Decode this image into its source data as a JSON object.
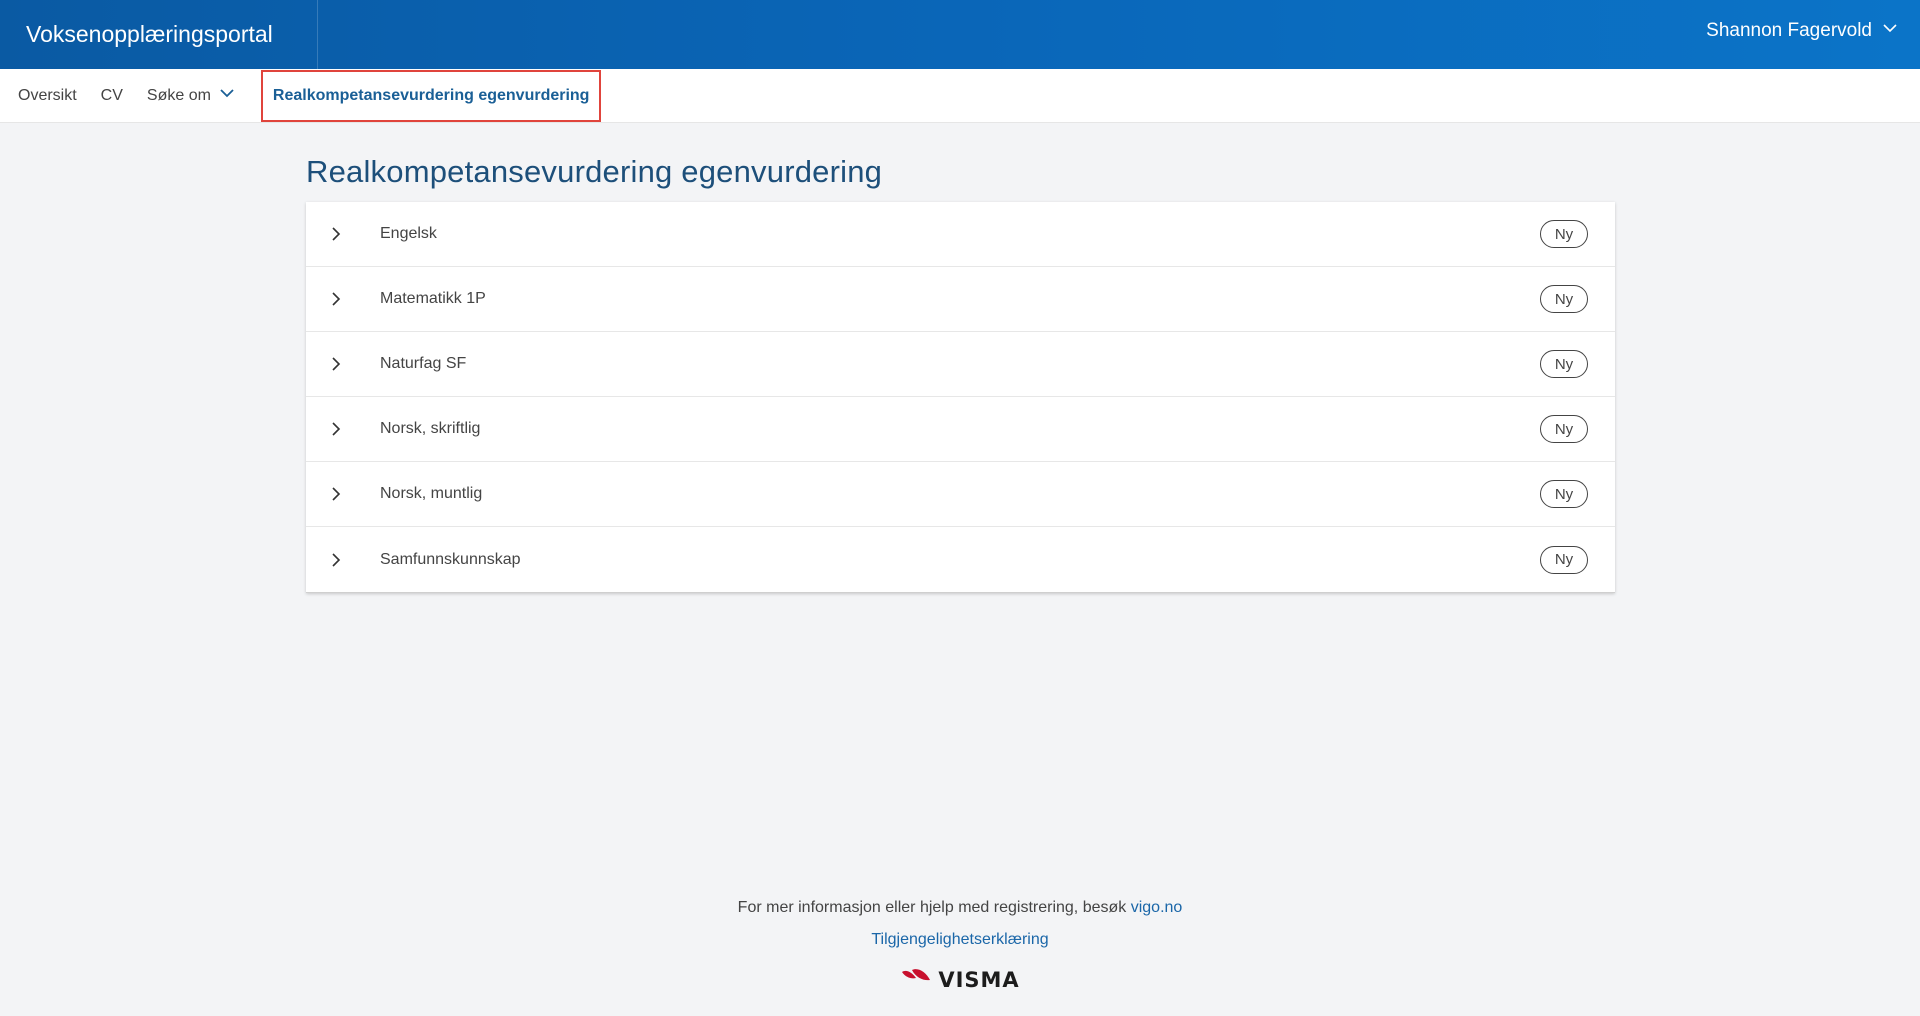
{
  "header": {
    "brand": "Voksenopplæringsportal",
    "user_name": "Shannon Fagervold",
    "user_icon": "chevron-down-icon"
  },
  "nav": {
    "items": [
      {
        "label": "Oversikt"
      },
      {
        "label": "CV"
      },
      {
        "label": "Søke om",
        "icon": "chevron-down-icon"
      },
      {
        "label": "Realkompetansevurdering egenvurdering",
        "active": true
      }
    ]
  },
  "main": {
    "title": "Realkompetansevurdering egenvurdering",
    "rows": [
      {
        "label": "Engelsk",
        "badge": "Ny"
      },
      {
        "label": "Matematikk 1P",
        "badge": "Ny"
      },
      {
        "label": "Naturfag SF",
        "badge": "Ny"
      },
      {
        "label": "Norsk, skriftlig",
        "badge": "Ny"
      },
      {
        "label": "Norsk, muntlig",
        "badge": "Ny"
      },
      {
        "label": "Samfunnskunnskap",
        "badge": "Ny"
      }
    ]
  },
  "footer": {
    "info_text": "For mer informasjon eller hjelp med registrering, besøk",
    "info_link": "vigo.no",
    "accessibility_link": "Tilgjengelighetserklæring",
    "logo_text": "VISMA"
  },
  "colors": {
    "header_bg": "#0a66b8",
    "accent": "#1a5f96",
    "active_outline": "#e0443c",
    "page_bg": "#f3f4f6"
  }
}
